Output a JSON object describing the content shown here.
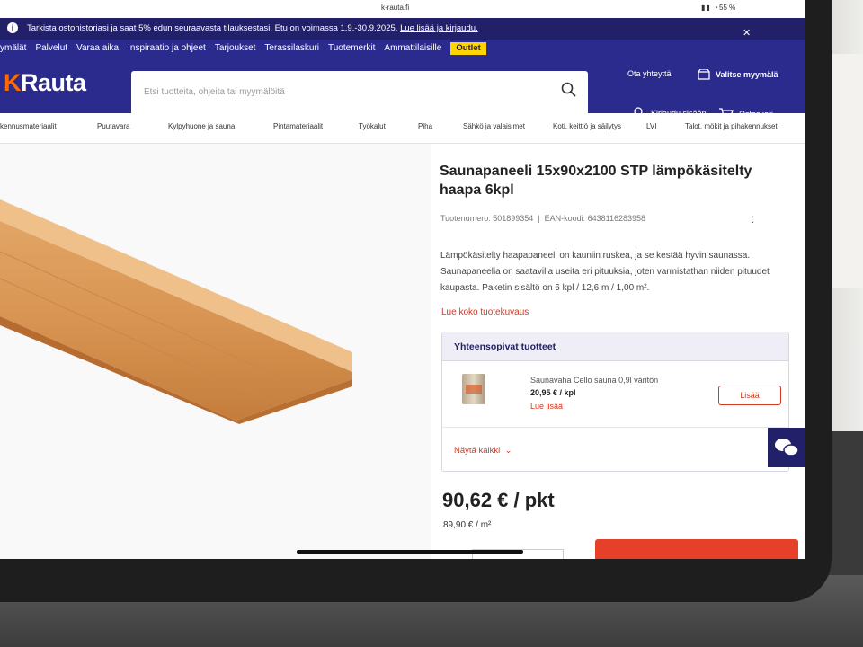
{
  "statusbar": {
    "url": "k-rauta.fi",
    "battery": "55 %"
  },
  "promo": {
    "text": "Tarkista ostohistoriasi ja saat 5% edun seuraavasta tilauksestasi. Etu on voimassa 1.9.-30.9.2025.",
    "link": "Lue lisää ja kirjaudu."
  },
  "topmenu": [
    "ymälät",
    "Palvelut",
    "Varaa aika",
    "Inspiraatio ja ohjeet",
    "Tarjoukset",
    "Terassilaskuri",
    "Tuotemerkit",
    "Ammattilaisille"
  ],
  "outlet": "Outlet",
  "logo": {
    "k": "K",
    "text": "Rauta"
  },
  "search": {
    "placeholder": "Etsi tuotteita, ohjeita tai myymälöitä"
  },
  "header": {
    "contact": "Ota yhteyttä",
    "store": "Valitse myymälä",
    "login": "Kirjaudu sisään",
    "cart": "Ostoskori"
  },
  "categories": [
    "kennusmateriaalit",
    "Puutavara",
    "Kylpyhuone ja sauna",
    "Pintamateriaalit",
    "Työkalut",
    "Piha",
    "Sähkö ja valaisimet",
    "Koti, keittiö ja säilytys",
    "LVI",
    "Talot, mökit ja pihakennukset"
  ],
  "product": {
    "title": "Saunapaneeli 15x90x2100 STP lämpökäsitelty haapa 6kpl",
    "sku_label": "Tuotenumero: 501899354",
    "ean_label": "EAN-koodi: 6438116283958",
    "description": "Lämpökäsitelty haapapaneeli on kauniin ruskea, ja se kestää hyvin saunassa. Saunapaneelia on saatavilla useita eri pituuksia, joten varmistathan niiden pituudet kaupasta. Paketin sisältö on 6 kpl / 12,6 m / 1,00 m².",
    "read_more": "Lue koko tuotekuvaus",
    "price": "90,62 € / pkt",
    "unit_price": "89,90 € / m²"
  },
  "compatible": {
    "heading": "Yhteensopivat tuotteet",
    "item": {
      "name": "Saunavaha Cello sauna 0,9l väritön",
      "price": "20,95 € / kpl",
      "read_more": "Lue lisää",
      "add": "Lisää"
    },
    "show_all": "Näytä kaikki"
  },
  "colors": {
    "brand_navy": "#2b2a8d",
    "accent_red": "#d2391f",
    "outlet_yellow": "#ffd500"
  }
}
